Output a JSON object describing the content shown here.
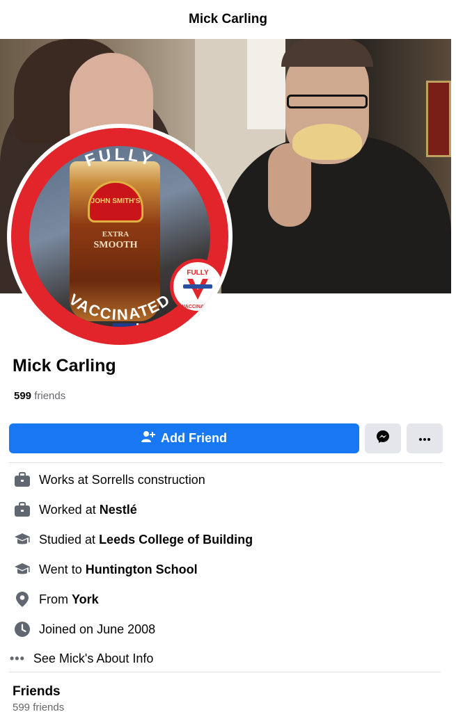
{
  "header": {
    "title": "Mick Carling"
  },
  "profile": {
    "name": "Mick Carling",
    "friend_count": "599",
    "friends_word": "friends",
    "avatar_ring_text_top": "FULLY",
    "avatar_ring_text_bottom": "VACCINATED",
    "avatar_glass_label_1": "JOHN SMITH'S",
    "avatar_glass_label_2": "EXTRA",
    "avatar_glass_label_3": "SMOOTH",
    "avatar_stamp_top": "FULLY",
    "avatar_stamp_bottom": "VACCINATED",
    "accent_color": "#e1252a"
  },
  "actions": {
    "add_friend_label": "Add Friend",
    "add_friend_icon": "person-add-icon",
    "messenger_icon": "messenger-icon",
    "more_icon": "more-dots-icon",
    "primary_color": "#1877f2"
  },
  "intro": [
    {
      "icon": "briefcase-icon",
      "prefix": "Works at Sorrells construction",
      "bold": ""
    },
    {
      "icon": "briefcase-icon",
      "prefix": "Worked at ",
      "bold": "Nestlé"
    },
    {
      "icon": "graduation-cap-icon",
      "prefix": "Studied at ",
      "bold": "Leeds College of Building"
    },
    {
      "icon": "graduation-cap-icon",
      "prefix": "Went to ",
      "bold": "Huntington School"
    },
    {
      "icon": "location-pin-icon",
      "prefix": "From ",
      "bold": "York"
    },
    {
      "icon": "clock-icon",
      "prefix": "Joined on June 2008",
      "bold": ""
    }
  ],
  "see_about": {
    "label": "See Mick's About Info",
    "icon": "more-dots-icon"
  },
  "friends_section": {
    "heading": "Friends",
    "count_text": "599 friends"
  }
}
